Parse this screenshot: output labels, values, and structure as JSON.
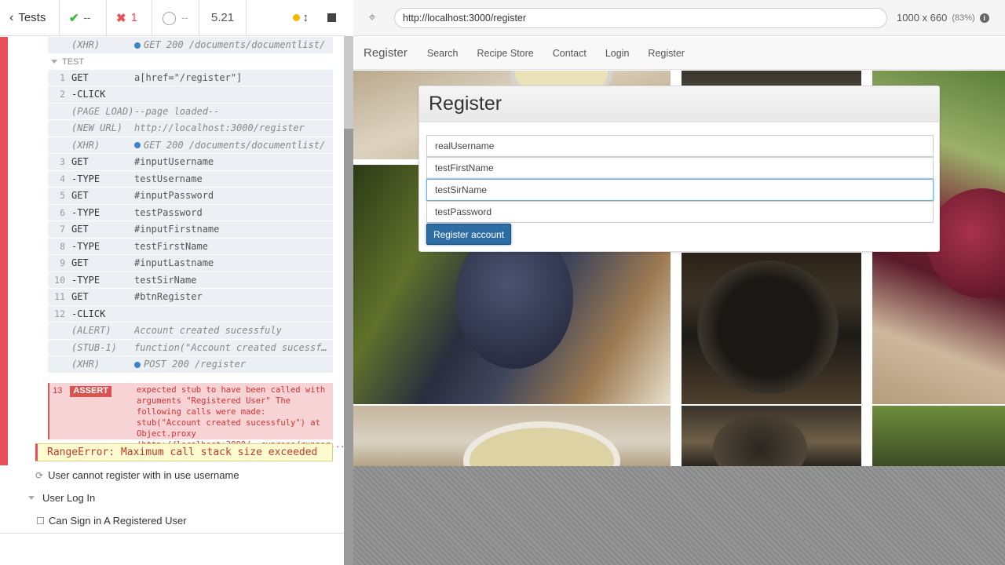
{
  "header": {
    "tests_label": "Tests",
    "passed": "--",
    "failed": "1",
    "pending": "--",
    "duration": "5.21"
  },
  "commands": [
    {
      "num": "",
      "name": "(XHR)",
      "msg": "GET 200 /documents/documentlist/",
      "event": true,
      "dot": true
    },
    {
      "section": "TEST"
    },
    {
      "num": "1",
      "name": "GET",
      "msg": "a[href=\"/register\"]"
    },
    {
      "num": "2",
      "name": "-CLICK",
      "msg": ""
    },
    {
      "num": "",
      "name": "(PAGE LOAD)",
      "msg": "--page loaded--",
      "event": true
    },
    {
      "num": "",
      "name": "(NEW URL)",
      "msg": "http://localhost:3000/register",
      "event": true
    },
    {
      "num": "",
      "name": "(XHR)",
      "msg": "GET 200 /documents/documentlist/",
      "event": true,
      "dot": true
    },
    {
      "num": "3",
      "name": "GET",
      "msg": "#inputUsername"
    },
    {
      "num": "4",
      "name": "-TYPE",
      "msg": "testUsername"
    },
    {
      "num": "5",
      "name": "GET",
      "msg": "#inputPassword"
    },
    {
      "num": "6",
      "name": "-TYPE",
      "msg": "testPassword"
    },
    {
      "num": "7",
      "name": "GET",
      "msg": "#inputFirstname"
    },
    {
      "num": "8",
      "name": "-TYPE",
      "msg": "testFirstName"
    },
    {
      "num": "9",
      "name": "GET",
      "msg": "#inputLastname"
    },
    {
      "num": "10",
      "name": "-TYPE",
      "msg": "testSirName"
    },
    {
      "num": "11",
      "name": "GET",
      "msg": "#btnRegister"
    },
    {
      "num": "12",
      "name": "-CLICK",
      "msg": ""
    },
    {
      "num": "",
      "name": "(ALERT)",
      "msg": "Account created sucessfuly",
      "event": true
    },
    {
      "num": "",
      "name": "(STUB-1)",
      "msg": "function(\"Account created sucessfuly\")",
      "event": true
    },
    {
      "num": "",
      "name": "(XHR)",
      "msg": "POST 200 /register",
      "event": true,
      "dot": true
    }
  ],
  "assert": {
    "num": "13",
    "badge": "ASSERT",
    "text": "expected stub to have been called with arguments \"Registered User\" The following calls were made: stub(\"Account created sucessfuly\") at Object.proxy (http://localhost:3000/__cypress/runner..."
  },
  "error": "RangeError: Maximum call stack size exceeded",
  "runnables": {
    "retry_test": "User cannot register with in use username",
    "suite": "User Log In",
    "pending_test": "Can Sign in A Registered User"
  },
  "aut_header": {
    "url": "http://localhost:3000/register",
    "viewport": "1000 x 660",
    "scale": "(83%)"
  },
  "app": {
    "brand": "Register",
    "nav": [
      "Search",
      "Recipe Store",
      "Contact",
      "Login",
      "Register"
    ],
    "panel_title": "Register",
    "inputs": [
      "realUsername",
      "testFirstName",
      "testSirName",
      "testPassword"
    ],
    "button": "Register account"
  },
  "colors": {
    "failed": "#e94f5b",
    "passed": "#33bb33",
    "button": "#2e6da4"
  }
}
